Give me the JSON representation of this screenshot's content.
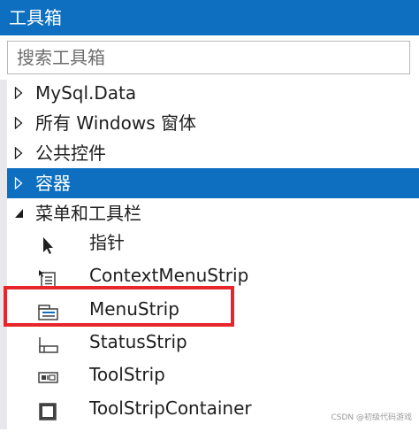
{
  "panel": {
    "title": "工具箱"
  },
  "search": {
    "placeholder": "搜索工具箱"
  },
  "categories": [
    {
      "label": "MySql.Data",
      "expanded": false
    },
    {
      "label": "所有 Windows 窗体",
      "expanded": false
    },
    {
      "label": "公共控件",
      "expanded": false
    },
    {
      "label": "容器",
      "expanded": false,
      "selected": true
    },
    {
      "label": "菜单和工具栏",
      "expanded": true
    }
  ],
  "items": [
    {
      "label": "指针",
      "icon": "pointer-icon"
    },
    {
      "label": "ContextMenuStrip",
      "icon": "context-menu-strip-icon"
    },
    {
      "label": "MenuStrip",
      "icon": "menu-strip-icon",
      "highlighted": true
    },
    {
      "label": "StatusStrip",
      "icon": "status-strip-icon"
    },
    {
      "label": "ToolStrip",
      "icon": "tool-strip-icon"
    },
    {
      "label": "ToolStripContainer",
      "icon": "tool-strip-container-icon"
    }
  ],
  "watermark": "CSDN @初级代码游戏",
  "colors": {
    "accent": "#0e6fc1",
    "highlight": "#e8252b"
  }
}
